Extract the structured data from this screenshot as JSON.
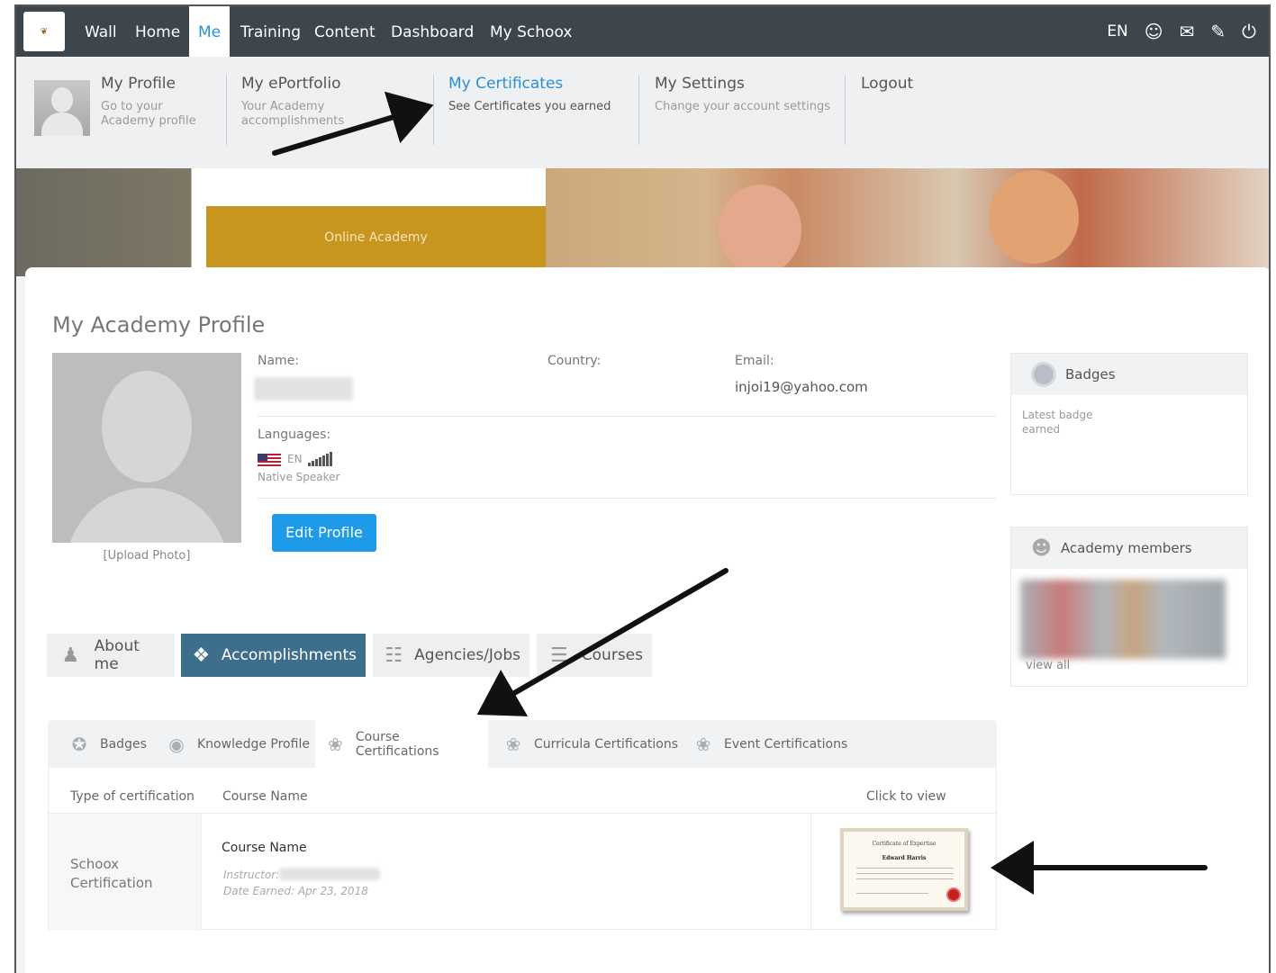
{
  "nav": {
    "items": [
      {
        "label": "Wall"
      },
      {
        "label": "Home"
      },
      {
        "label": "Me"
      },
      {
        "label": "Training"
      },
      {
        "label": "Content"
      },
      {
        "label": "Dashboard"
      },
      {
        "label": "My Schoox"
      }
    ],
    "active": "Me",
    "language": "EN"
  },
  "menu": {
    "profile": {
      "title": "My Profile",
      "sub": "Go to your Academy profile"
    },
    "eportfolio": {
      "title": "My ePortfolio",
      "sub": "Your Academy accomplishments"
    },
    "certificates": {
      "title": "My Certificates",
      "sub": "See Certificates you earned"
    },
    "settings": {
      "title": "My Settings",
      "sub": "Change your account settings"
    },
    "logout": {
      "title": "Logout"
    }
  },
  "banner": {
    "academy_label": "Online Academy"
  },
  "profile": {
    "title": "My Academy Profile",
    "upload_label": "[Upload Photo]",
    "name_label": "Name:",
    "country_label": "Country:",
    "email_label": "Email:",
    "email_value": "injoi19@yahoo.com",
    "languages_label": "Languages:",
    "language_code": "EN",
    "language_level": "Native Speaker",
    "edit_button": "Edit Profile"
  },
  "badges_box": {
    "title": "Badges",
    "body": "Latest badge earned"
  },
  "members_box": {
    "title": "Academy members",
    "view_all": "view all"
  },
  "main_tabs": [
    {
      "label": "About me"
    },
    {
      "label": "Accomplishments"
    },
    {
      "label": "Agencies/Jobs"
    },
    {
      "label": "Courses"
    }
  ],
  "sub_tabs": [
    {
      "label": "Badges"
    },
    {
      "label": "Knowledge Profile"
    },
    {
      "label": "Course Certifications"
    },
    {
      "label": "Curricula Certifications"
    },
    {
      "label": "Event Certifications"
    }
  ],
  "table": {
    "headers": {
      "type": "Type of certification",
      "course": "Course Name",
      "view": "Click to view"
    },
    "rows": [
      {
        "type": "Schoox Certification",
        "course_name": "Course Name",
        "instructor_label": "Instructor:",
        "date_earned": "Date Earned: Apr 23, 2018"
      }
    ]
  },
  "certificate_thumb": {
    "heading": "Certificate of Expertise",
    "name": "Edward Harris"
  },
  "colors": {
    "nav_bg": "#3d454d",
    "accent": "#2b8fd6",
    "button": "#1e9be8",
    "active_tab": "#3d6e8c",
    "banner_gold": "#c8961e"
  }
}
